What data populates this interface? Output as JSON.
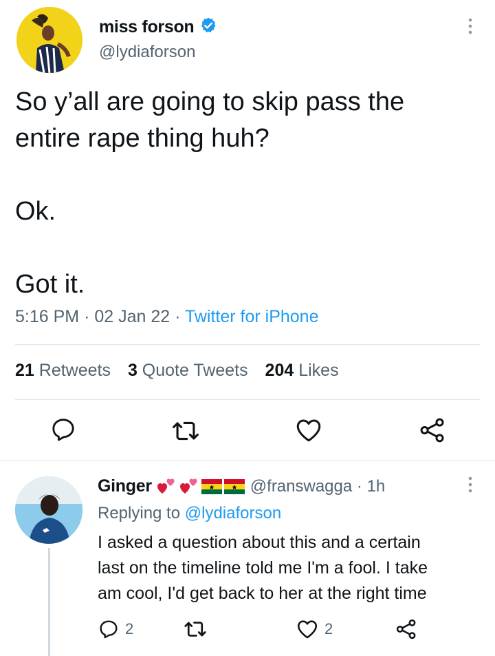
{
  "tweet": {
    "author": {
      "name": "miss forson",
      "handle": "@lydiaforson",
      "verified": true
    },
    "text": "So y’all are going to skip pass the\nentire rape thing  huh?\n\nOk.\n\nGot it.",
    "time": "5:16 PM",
    "date": "02 Jan 22",
    "source": "Twitter for iPhone",
    "stats": {
      "retweets_count": "21",
      "retweets_label": "Retweets",
      "quotes_count": "3",
      "quotes_label": "Quote Tweets",
      "likes_count": "204",
      "likes_label": "Likes"
    },
    "actions": [
      "reply-icon",
      "retweet-icon",
      "like-icon",
      "share-icon"
    ]
  },
  "reply": {
    "author": {
      "name": "Ginger",
      "handle": "@franswagga",
      "time": "1h",
      "emojis": [
        "heart-icon",
        "heart-icon",
        "ghana-flag-icon",
        "ghana-flag-icon"
      ]
    },
    "replying_label": "Replying to",
    "replying_to": "@lydiaforson",
    "text": "I asked a question about this and a certain\nlast on the timeline told me I'm a fool. I take\nam cool, I'd get back to her at the right time",
    "reply_count": "2",
    "like_count": "2"
  },
  "colors": {
    "accent": "#1d9bf0",
    "secondary_text": "#536471",
    "primary_text": "#0f1419",
    "divider": "#e1e5e8"
  }
}
